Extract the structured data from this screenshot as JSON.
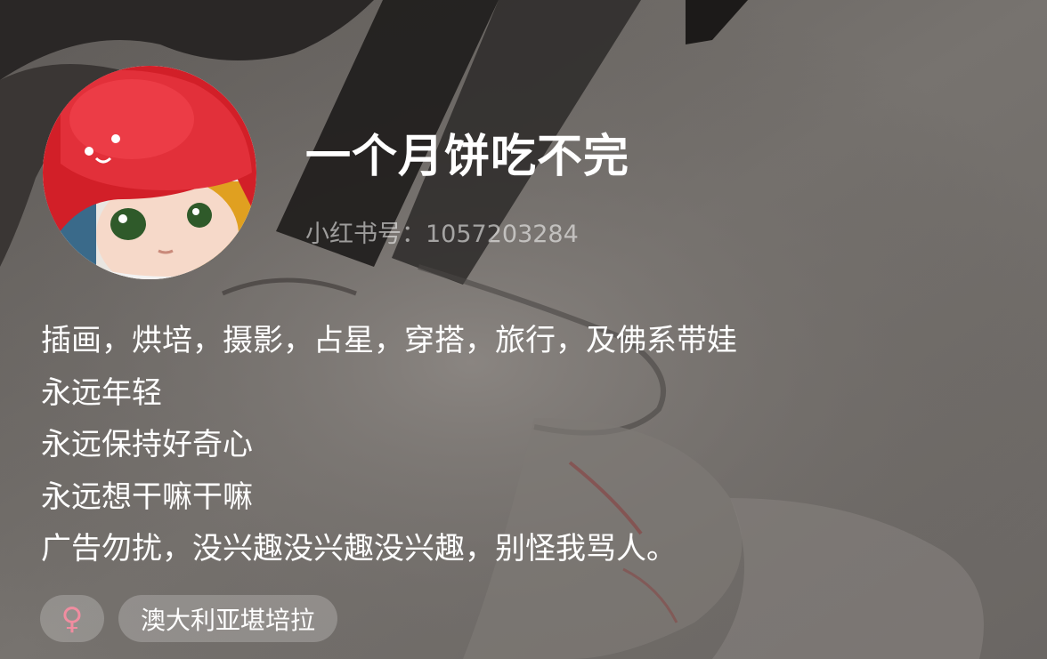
{
  "profile": {
    "username": "一个月饼吃不完",
    "account_id": "小红书号：1057203284",
    "avatar_icon": "avatar-doll-red-hair"
  },
  "bio": {
    "lines": [
      "插画，烘培，摄影，占星，穿搭，旅行，及佛系带娃",
      "永远年轻",
      "永远保持好奇心",
      "永远想干嘛干嘛",
      "广告勿扰，没兴趣没兴趣没兴趣，别怪我骂人。"
    ]
  },
  "tags": {
    "gender_icon": "♀",
    "gender_color": "#f08da0",
    "location": "澳大利亚堪培拉"
  },
  "colors": {
    "text": "#ffffff",
    "muted_text": "rgba(255,255,255,0.55)",
    "tag_bg": "rgba(255,255,255,0.22)",
    "avatar_red": "#d8202a"
  }
}
